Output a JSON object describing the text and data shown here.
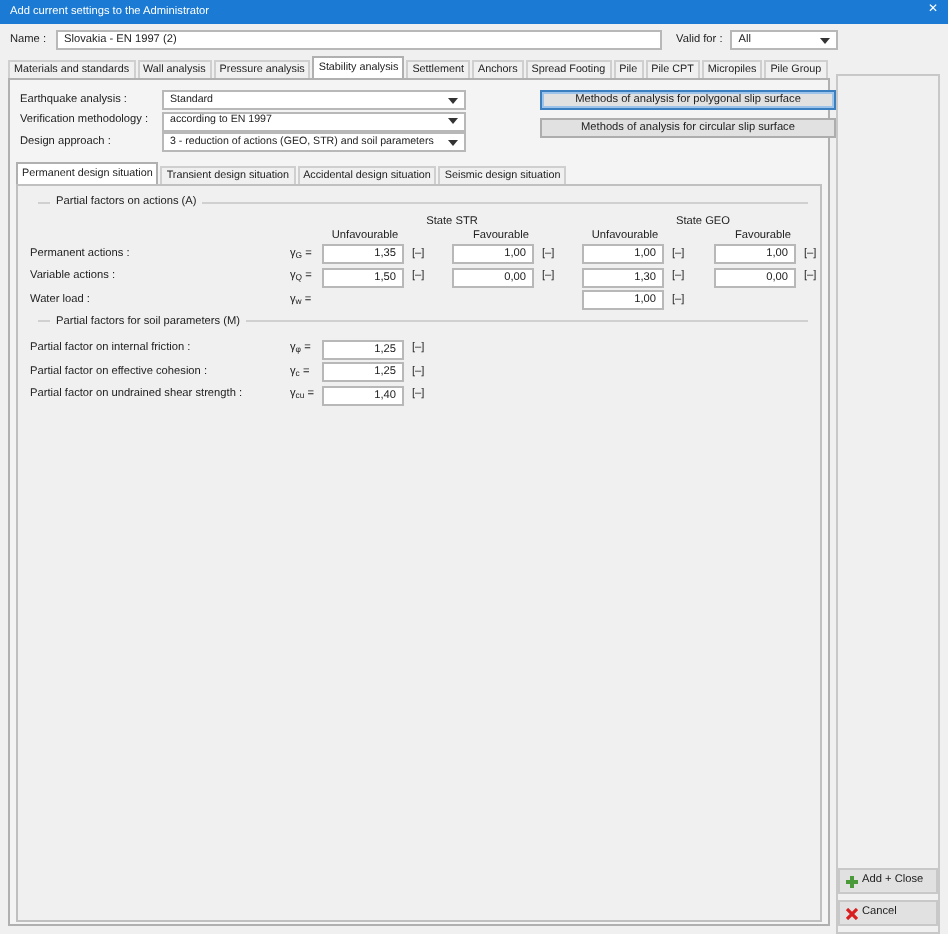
{
  "window": {
    "title": "Add current settings to the Administrator",
    "close": "✕"
  },
  "name": {
    "label": "Name :",
    "value": "Slovakia - EN 1997 (2)"
  },
  "valid_for": {
    "label": "Valid for :",
    "value": "All"
  },
  "tabs": [
    {
      "label": "Materials and standards",
      "selected": false
    },
    {
      "label": "Wall analysis",
      "selected": false
    },
    {
      "label": "Pressure analysis",
      "selected": false
    },
    {
      "label": "Stability analysis",
      "selected": true
    },
    {
      "label": "Settlement",
      "selected": false
    },
    {
      "label": "Anchors",
      "selected": false
    },
    {
      "label": "Spread Footing",
      "selected": false
    },
    {
      "label": "Pile",
      "selected": false
    },
    {
      "label": "Pile CPT",
      "selected": false
    },
    {
      "label": "Micropiles",
      "selected": false
    },
    {
      "label": "Pile Group",
      "selected": false
    }
  ],
  "settings": [
    {
      "label": "Earthquake analysis :",
      "value": "Standard"
    },
    {
      "label": "Verification methodology :",
      "value": "according to EN 1997"
    },
    {
      "label": "Design approach :",
      "value": "3 - reduction of actions (GEO, STR) and soil parameters"
    }
  ],
  "method_buttons": [
    {
      "label": "Methods of analysis for polygonal slip surface",
      "focused": true
    },
    {
      "label": "Methods of analysis for circular slip surface",
      "focused": false
    }
  ],
  "sub_tabs": [
    {
      "label": "Permanent design situation",
      "selected": true
    },
    {
      "label": "Transient design situation",
      "selected": false
    },
    {
      "label": "Accidental design situation",
      "selected": false
    },
    {
      "label": "Seismic design situation",
      "selected": false
    }
  ],
  "actions_group": {
    "title": "Partial factors on actions (A)",
    "states": [
      {
        "title": "State STR",
        "columns": [
          "Unfavourable",
          "Favourable"
        ]
      },
      {
        "title": "State GEO",
        "columns": [
          "Unfavourable",
          "Favourable"
        ]
      }
    ],
    "rows": [
      {
        "label": "Permanent actions :",
        "symbol": "γ$_{G}$ =",
        "values": [
          {
            "kind": "str_unfavourable",
            "value": "1,35",
            "unit": "[–]"
          },
          {
            "kind": "str_favourable",
            "value": "1,00",
            "unit": "[–]"
          },
          {
            "kind": "geo_unfavourable",
            "value": "1,00",
            "unit": "[–]"
          },
          {
            "kind": "geo_favourable",
            "value": "1,00",
            "unit": "[–]"
          }
        ]
      },
      {
        "label": "Variable actions :",
        "symbol": "γ$_{Q}$ =",
        "values": [
          {
            "kind": "str_unfavourable",
            "value": "1,50",
            "unit": "[–]"
          },
          {
            "kind": "str_favourable",
            "value": "0,00",
            "unit": "[–]"
          },
          {
            "kind": "geo_unfavourable",
            "value": "1,30",
            "unit": "[–]"
          },
          {
            "kind": "geo_favourable",
            "value": "0,00",
            "unit": "[–]"
          }
        ]
      },
      {
        "label": "Water load :",
        "symbol": "γ$_{w}$ =",
        "values": [
          {
            "kind": "geo_unfavourable",
            "value": "1,00",
            "unit": "[–]"
          }
        ]
      }
    ]
  },
  "soil_group": {
    "title": "Partial factors for soil parameters (M)",
    "rows": [
      {
        "label": "Partial factor on internal friction :",
        "symbol": "γ$_{φ}$ =",
        "value": "1,25",
        "unit": "[–]"
      },
      {
        "label": "Partial factor on effective cohesion :",
        "symbol": "γ$_{c}$ =",
        "value": "1,25",
        "unit": "[–]"
      },
      {
        "label": "Partial factor on undrained shear strength :",
        "symbol": "γ$_{cu}$ =",
        "value": "1,40",
        "unit": "[–]"
      }
    ]
  },
  "footer_buttons": [
    {
      "label": "Add + Close",
      "kind": "add"
    },
    {
      "label": "Cancel",
      "kind": "cancel"
    }
  ]
}
